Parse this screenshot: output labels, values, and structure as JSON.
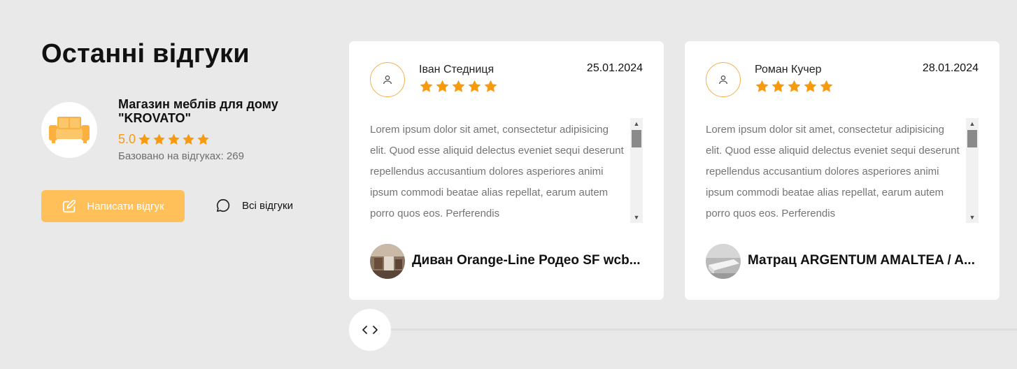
{
  "section": {
    "title": "Останні відгуки"
  },
  "store": {
    "name": "Магазин меблів для дому \"KROVATO\"",
    "score": "5.0",
    "stars": 5,
    "based_on": "Базовано на відгуках: 269",
    "logo_icon": "sofa-icon"
  },
  "actions": {
    "write_review": "Написати відгук",
    "all_reviews": "Всі відгуки"
  },
  "reviews": [
    {
      "author": "Іван Стедниця",
      "date": "25.01.2024",
      "stars": 5,
      "text": "Lorem ipsum dolor sit amet, consectetur adipisicing elit. Quod esse aliquid delectus eveniet sequi deserunt repellendus accusantium dolores asperiores animi ipsum commodi beatae alias repellat, earum autem porro quos eos. Perferendis",
      "product": "Диван Orange-Line Родео SF wcb..."
    },
    {
      "author": "Роман Кучер",
      "date": "28.01.2024",
      "stars": 5,
      "text": "Lorem ipsum dolor sit amet, consectetur adipisicing elit. Quod esse aliquid delectus eveniet sequi deserunt repellendus accusantium dolores asperiores animi ipsum commodi beatae alias repellat, earum autem porro quos eos. Perferendis",
      "product": "Матрац ARGENTUM AMALTEA / A..."
    }
  ],
  "colors": {
    "accent": "#f79a10",
    "button": "#ffc05a",
    "background": "#e9e9e9"
  }
}
